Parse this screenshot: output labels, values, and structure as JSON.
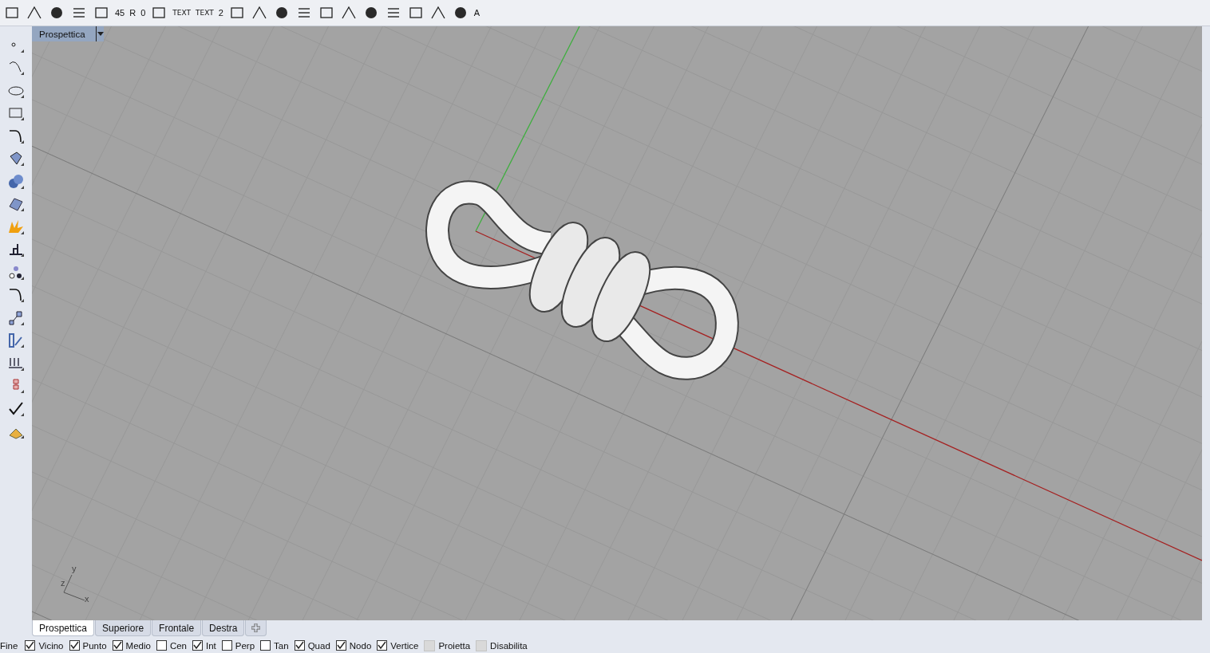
{
  "top_toolbar": [
    {
      "kind": "icon"
    },
    {
      "kind": "icon"
    },
    {
      "kind": "icon"
    },
    {
      "kind": "icon"
    },
    {
      "kind": "icon"
    },
    {
      "kind": "glyph",
      "text": "45"
    },
    {
      "kind": "glyph",
      "text": "R"
    },
    {
      "kind": "glyph",
      "text": "0"
    },
    {
      "kind": "icon"
    },
    {
      "kind": "label",
      "text": "TEXT"
    },
    {
      "kind": "label",
      "text": "TEXT"
    },
    {
      "kind": "glyph",
      "text": "2"
    },
    {
      "kind": "icon"
    },
    {
      "kind": "icon"
    },
    {
      "kind": "icon"
    },
    {
      "kind": "icon"
    },
    {
      "kind": "icon"
    },
    {
      "kind": "icon"
    },
    {
      "kind": "icon"
    },
    {
      "kind": "icon"
    },
    {
      "kind": "icon"
    },
    {
      "kind": "icon"
    },
    {
      "kind": "icon"
    },
    {
      "kind": "glyph",
      "text": "A"
    }
  ],
  "viewport": {
    "title": "Prospettica",
    "axes": {
      "y": "y",
      "z": "z",
      "x": "x"
    }
  },
  "view_tabs": [
    {
      "label": "Prospettica",
      "selected": true
    },
    {
      "label": "Superiore",
      "selected": false
    },
    {
      "label": "Frontale",
      "selected": false
    },
    {
      "label": "Destra",
      "selected": false
    }
  ],
  "osnaps": [
    {
      "kind": "cut",
      "label": "Fine"
    },
    {
      "kind": "check",
      "label": "Vicino",
      "checked": true
    },
    {
      "kind": "check",
      "label": "Punto",
      "checked": true
    },
    {
      "kind": "check",
      "label": "Medio",
      "checked": true
    },
    {
      "kind": "check",
      "label": "Cen",
      "checked": false
    },
    {
      "kind": "check",
      "label": "Int",
      "checked": true
    },
    {
      "kind": "check",
      "label": "Perp",
      "checked": false
    },
    {
      "kind": "check",
      "label": "Tan",
      "checked": false
    },
    {
      "kind": "check",
      "label": "Quad",
      "checked": true
    },
    {
      "kind": "check",
      "label": "Nodo",
      "checked": true
    },
    {
      "kind": "check",
      "label": "Vertice",
      "checked": true
    },
    {
      "kind": "toggle",
      "label": "Proietta",
      "on": false
    },
    {
      "kind": "toggle",
      "label": "Disabilita",
      "on": false
    }
  ]
}
